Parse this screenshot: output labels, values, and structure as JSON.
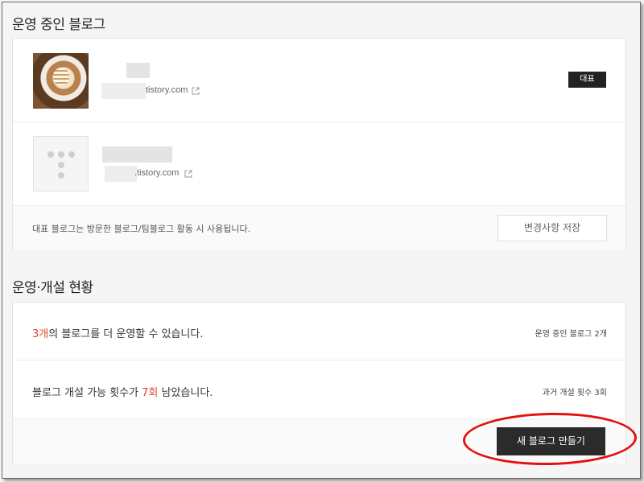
{
  "active_blogs": {
    "title": "운영 중인 블로그",
    "blogs": [
      {
        "url_suffix": "tistory.com",
        "badge": "대표"
      },
      {
        "url_suffix": ".tistory.com"
      }
    ],
    "note": "대표 블로그는 방문한 블로그/팀블로그 활동 시 사용됩니다.",
    "save_button": "변경사항 저장"
  },
  "status": {
    "title": "운영·개설 현황",
    "row1": {
      "count": "3개",
      "text": "의 블로그를 더 운영할 수 있습니다.",
      "right": "운영 중인 블로그 2개"
    },
    "row2": {
      "prefix": "블로그 개설 가능 횟수가 ",
      "count": "7회",
      "suffix": " 남았습니다.",
      "right": "과거 개설 횟수 3회"
    },
    "new_blog_button": "새 블로그 만들기"
  },
  "colors": {
    "accent_red": "#e0442e",
    "dark_button": "#2b2b2b",
    "annotation_red": "#e41010"
  }
}
